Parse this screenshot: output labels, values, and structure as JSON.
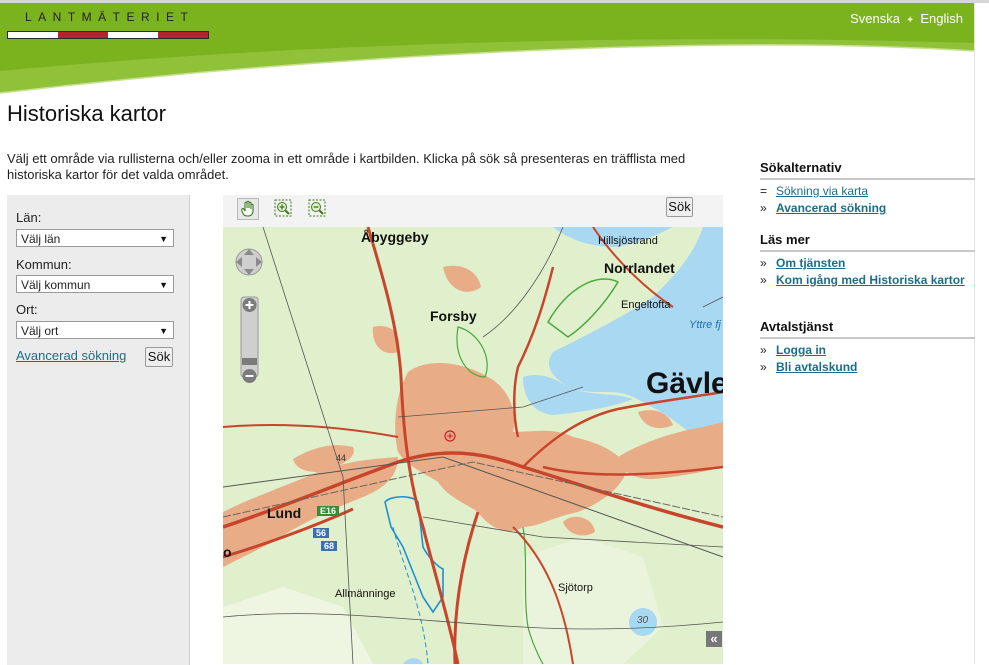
{
  "header": {
    "logo_text": "LANTMÄTERIET",
    "lang_sv": "Svenska",
    "lang_en": "English",
    "lang_sep": "✦"
  },
  "page": {
    "title": "Historiska kartor",
    "intro": "Välj ett område via rullisterna och/eller zooma in ett område i kartbilden. Klicka på sök så presenteras en träfflista med historiska kartor för det valda området."
  },
  "search_form": {
    "lan_label": "Län:",
    "lan_value": "Välj län",
    "kommun_label": "Kommun:",
    "kommun_value": "Välj kommun",
    "ort_label": "Ort:",
    "ort_value": "Välj ort",
    "advanced_link": "Avancerad sökning",
    "search_button": "Sök"
  },
  "map": {
    "search_button": "Sök",
    "tools": [
      "hand-pan-icon",
      "zoom-in-box-icon",
      "zoom-out-box-icon"
    ],
    "places": {
      "abyggeby": "Åbyggeby",
      "hillsjostrand": "Hillsjöstrand",
      "norrlandet": "Norrlandet",
      "engeltofta": "Engeltofta",
      "forsby": "Forsby",
      "yttre": "Yttre fj",
      "gavle": "Gävle",
      "lund": "Lund",
      "allmanninge": "Allmänninge",
      "sjotorp": "Sjötorp",
      "o": "o"
    },
    "road_signs": {
      "e16": "E16",
      "r56": "56",
      "r68": "68"
    },
    "number_44": "44",
    "number_30": "30",
    "collapse_label": "«"
  },
  "sidebar": {
    "sokalternativ": {
      "title": "Sökalternativ",
      "items": [
        {
          "bullet": "=",
          "label": "Sökning via karta",
          "bold": false
        },
        {
          "bullet": "»",
          "label": "Avancerad sökning",
          "bold": true
        }
      ]
    },
    "las_mer": {
      "title": "Läs mer",
      "items": [
        {
          "bullet": "»",
          "label": "Om tjänsten"
        },
        {
          "bullet": "»",
          "label": "Kom igång med Historiska kartor"
        }
      ]
    },
    "avtal": {
      "title": "Avtalstjänst",
      "items": [
        {
          "bullet": "»",
          "label": "Logga in"
        },
        {
          "bullet": "»",
          "label": "Bli avtalskund"
        }
      ]
    }
  },
  "colors": {
    "brand_green": "#7bb31f",
    "brand_red": "#b5242b",
    "link": "#1a6e8a",
    "map_urban": "#e8ad87",
    "map_water": "#a9d8f2",
    "map_forest": "#e0efcc"
  }
}
